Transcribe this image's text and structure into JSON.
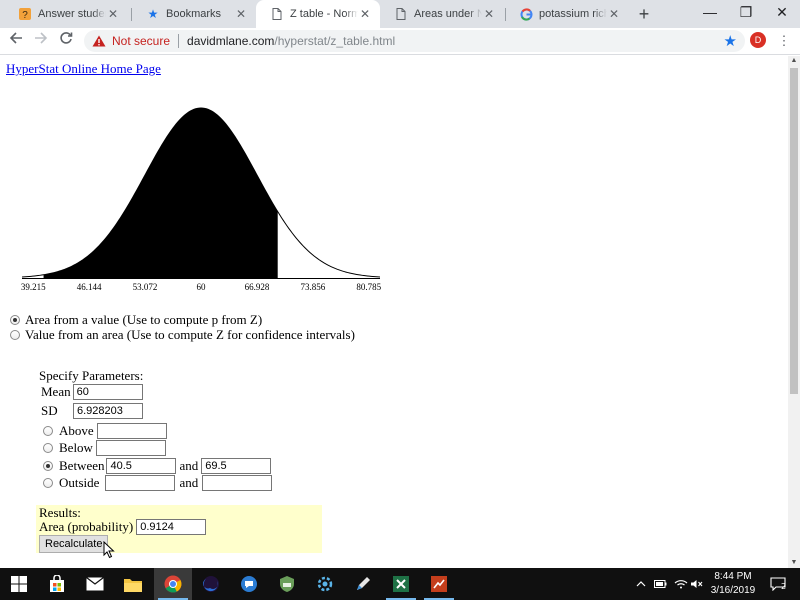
{
  "tabs": [
    {
      "title": "Answer students'",
      "icon": "quiz-favicon",
      "active": false
    },
    {
      "title": "Bookmarks",
      "icon": "star-favicon",
      "active": false
    },
    {
      "title": "Z table - Normal Dist",
      "icon": "page-favicon",
      "active": true
    },
    {
      "title": "Areas under Normal",
      "icon": "page-favicon",
      "active": false
    },
    {
      "title": "potassium rich foods",
      "icon": "google-favicon",
      "active": false
    }
  ],
  "window": {
    "minimize": "—",
    "restore": "❐",
    "close": "✕",
    "new_tab": "+"
  },
  "toolbar": {
    "security_label": "Not secure",
    "url_host": "davidmlane.com",
    "url_path": "/hyperstat/z_table.html",
    "profile_initial": "D",
    "accent_color": "#1a73e8"
  },
  "page": {
    "home_link": "HyperStat Online Home Page",
    "curve": {
      "mean": 60,
      "sd": 6.928203,
      "shade_from": 40.5,
      "shade_to": 69.5,
      "tick_labels": [
        "39.215",
        "46.144",
        "53.072",
        "60",
        "66.928",
        "73.856",
        "80.785"
      ]
    },
    "modes": [
      {
        "label": "Area from a value (Use to compute p from Z)",
        "checked": true
      },
      {
        "label": "Value from an area (Use to compute Z for confidence intervals)",
        "checked": false
      }
    ],
    "params": {
      "heading": "Specify Parameters:",
      "mean_label": "Mean",
      "mean_value": "60",
      "sd_label": "SD",
      "sd_value": "6.928203",
      "above_label": "Above",
      "above_value": "",
      "below_label": "Below",
      "below_value": "",
      "between_label": "Between",
      "between_low": "40.5",
      "between_and": "and",
      "between_high": "69.5",
      "outside_label": "Outside",
      "outside_low": "",
      "outside_and": "and",
      "outside_high": "",
      "selected": "between"
    },
    "results": {
      "heading": "Results:",
      "area_label": "Area (probability)",
      "area_value": "0.9124",
      "button_label": "Recalculate",
      "background": "#ffffcc"
    }
  },
  "taskbar": {
    "apps": [
      {
        "name": "windows-start-icon"
      },
      {
        "name": "store-icon"
      },
      {
        "name": "mail-icon"
      },
      {
        "name": "file-explorer-icon"
      },
      {
        "name": "chrome-icon",
        "running": true,
        "active": true
      },
      {
        "name": "firefox-icon"
      },
      {
        "name": "teams-icon"
      },
      {
        "name": "shield-app-icon"
      },
      {
        "name": "settings-app-icon"
      },
      {
        "name": "pen-app-icon"
      },
      {
        "name": "excel-icon",
        "running": true
      },
      {
        "name": "powerpoint-icon",
        "running": true
      }
    ],
    "time": "8:44 PM",
    "date": "3/16/2019",
    "notification_count": "2"
  }
}
